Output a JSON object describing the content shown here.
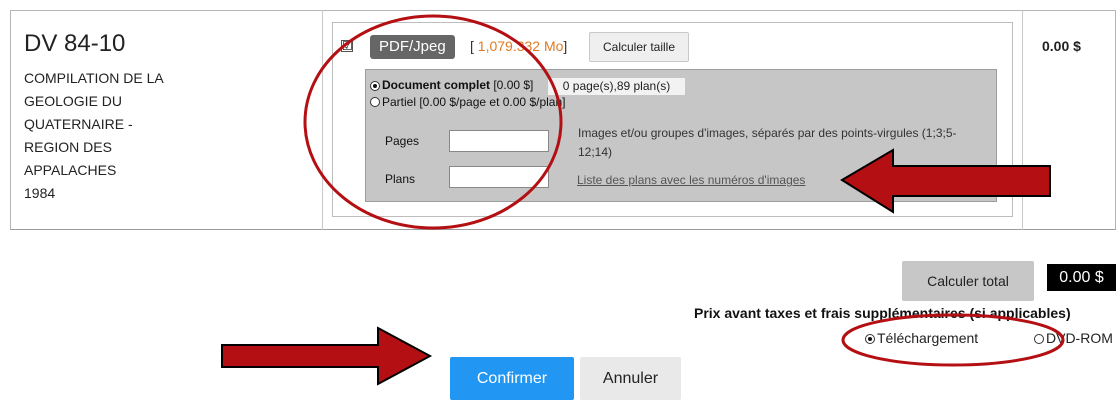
{
  "product": {
    "code": "DV 84-10",
    "description_lines": [
      "COMPILATION DE LA",
      "GEOLOGIE DU",
      "QUATERNAIRE -",
      "REGION DES",
      "APPALACHES",
      "1984"
    ],
    "price": "0.00 $"
  },
  "format": {
    "checkbox_mark": "☑",
    "label": "PDF/Jpeg",
    "size_open": "[ ",
    "size_value": "1,079.332 Mo",
    "size_close": "]",
    "calc_size_label": "Calculer taille"
  },
  "mode": {
    "complete_label_bold": "Document complet",
    "complete_label_price": " [0.00 $]",
    "count_text": "0 page(s),89 plan(s)",
    "partial_label": "Partiel [0.00 $/page et 0.00 $/plan]",
    "pages_label": "Pages",
    "plans_label": "Plans",
    "pages_value": "",
    "plans_value": "",
    "help_text": "Images et/ou groupes d'images, séparés par des points-virgules (1;3;5-12;14)",
    "plans_link": "Liste des plans avec les numéros d'images"
  },
  "totals": {
    "calc_total_label": "Calculer total",
    "total_value": "0.00 $",
    "price_note": "Prix avant taxes et frais supplémentaires (si applicables)"
  },
  "delivery": {
    "download_label": "Téléchargement",
    "dvd_label": "DVD-ROM",
    "selected": "download"
  },
  "actions": {
    "confirm_label": "Confirmer",
    "cancel_label": "Annuler"
  },
  "colors": {
    "accent_blue": "#2196f3",
    "annotation_red": "#b40f12",
    "size_orange": "#e07b22"
  },
  "annotations": {
    "icons": [
      "circle-highlight",
      "arrow-left-icon",
      "arrow-right-icon"
    ]
  }
}
